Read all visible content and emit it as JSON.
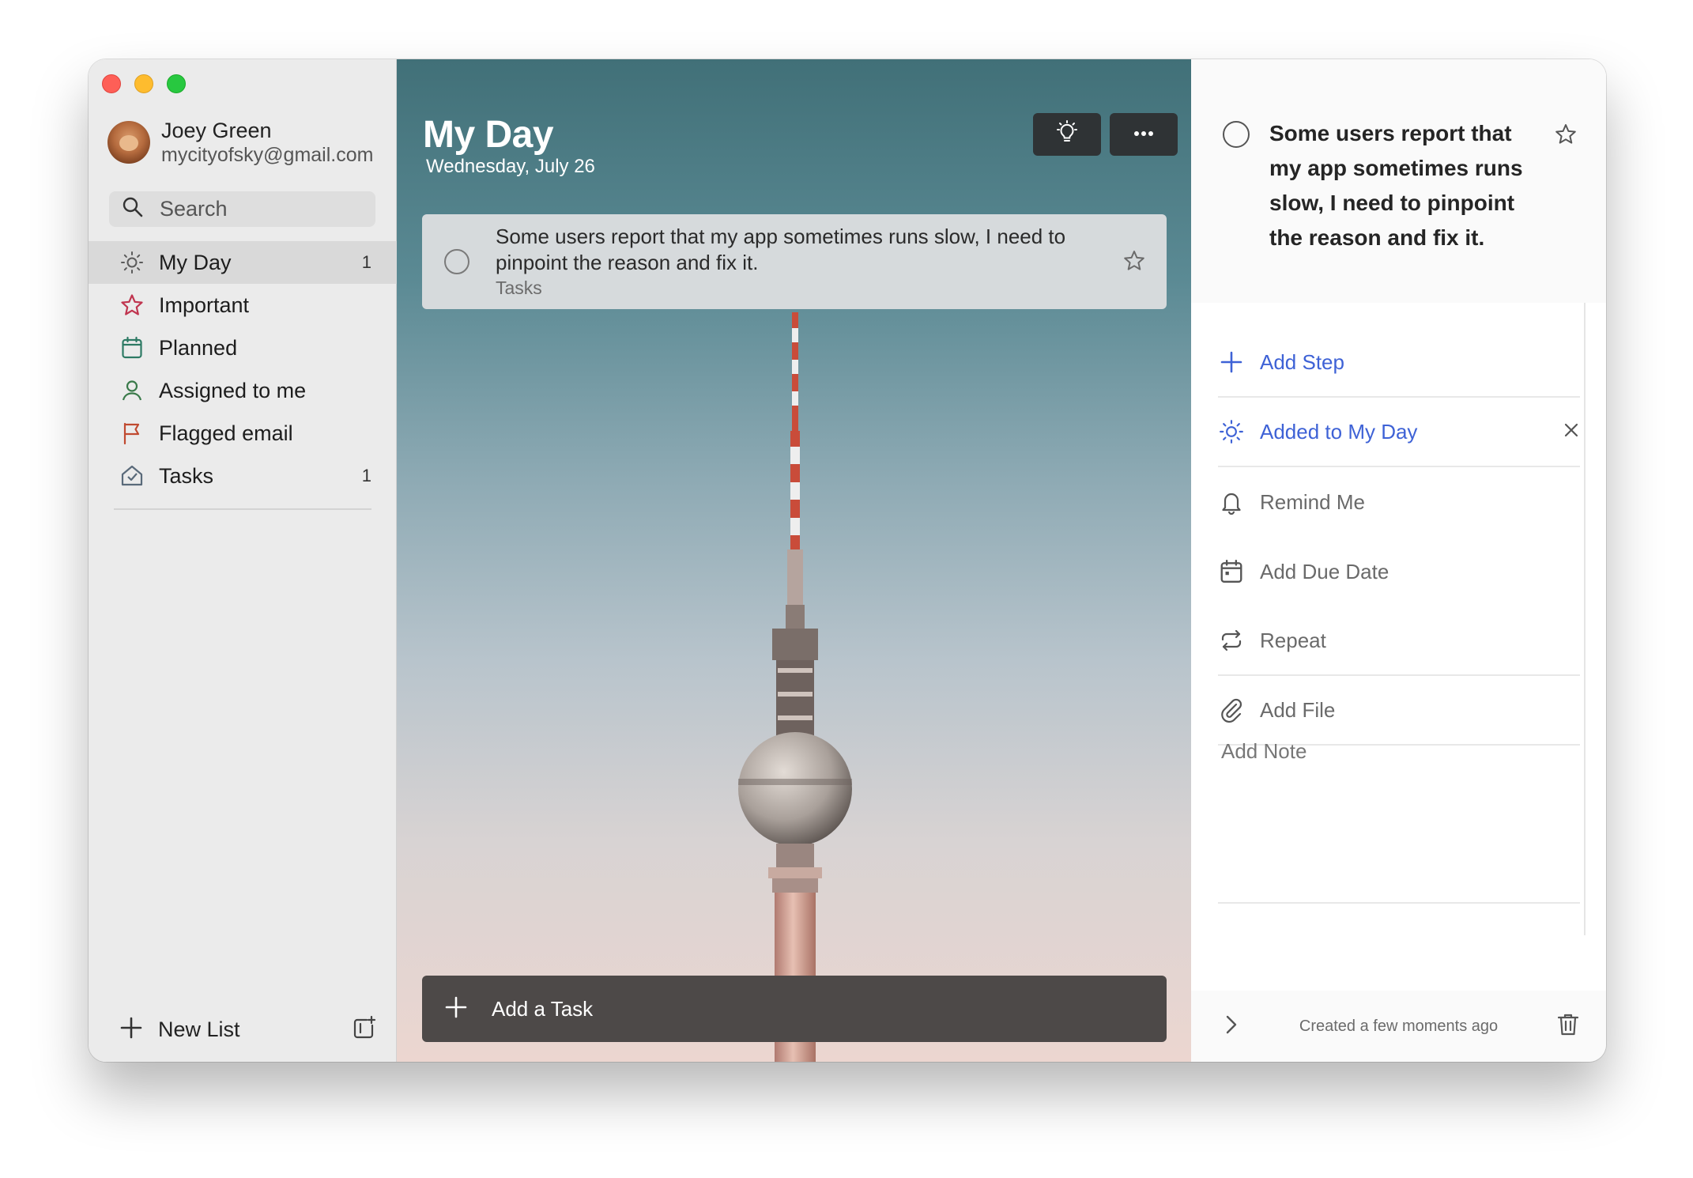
{
  "window": {
    "controls": [
      "close",
      "minimize",
      "zoom"
    ]
  },
  "sidebar": {
    "profile": {
      "name": "Joey Green",
      "email": "mycityofsky@gmail.com"
    },
    "search": {
      "label": "Search",
      "icon": "search-icon"
    },
    "items": [
      {
        "label": "My Day",
        "count": "1",
        "icon": "sun-icon",
        "color": "#5a5a5a",
        "active": true
      },
      {
        "label": "Important",
        "count": "",
        "icon": "star-icon",
        "color": "#c0354f"
      },
      {
        "label": "Planned",
        "count": "",
        "icon": "calendar-icon",
        "color": "#2d7a64"
      },
      {
        "label": "Assigned to me",
        "count": "",
        "icon": "person-icon",
        "color": "#3a7a4a"
      },
      {
        "label": "Flagged email",
        "count": "",
        "icon": "flag-icon",
        "color": "#c04a30"
      },
      {
        "label": "Tasks",
        "count": "1",
        "icon": "house-icon",
        "color": "#5a6a7a"
      }
    ],
    "new_list": {
      "label": "New List",
      "icon": "plus-icon",
      "group_icon": "new-group-icon"
    }
  },
  "main": {
    "title": "My Day",
    "date": "Wednesday, July 26",
    "suggestions_icon": "lightbulb-icon",
    "more_icon": "more-icon",
    "task": {
      "title": "Some users report that my app sometimes runs slow, I need to pinpoint the reason and fix it.",
      "list": "Tasks"
    },
    "add_task_label": "Add a Task"
  },
  "detail": {
    "title": "Some users report that my app sometimes runs slow, I need to pinpoint the reason and fix it.",
    "add_step": "Add Step",
    "added_to_my_day": "Added to My Day",
    "remind_me": "Remind Me",
    "add_due_date": "Add Due Date",
    "repeat": "Repeat",
    "add_file": "Add File",
    "add_note": "Add Note",
    "footer": "Created a few moments ago",
    "accent_color": "#3e62d6"
  }
}
